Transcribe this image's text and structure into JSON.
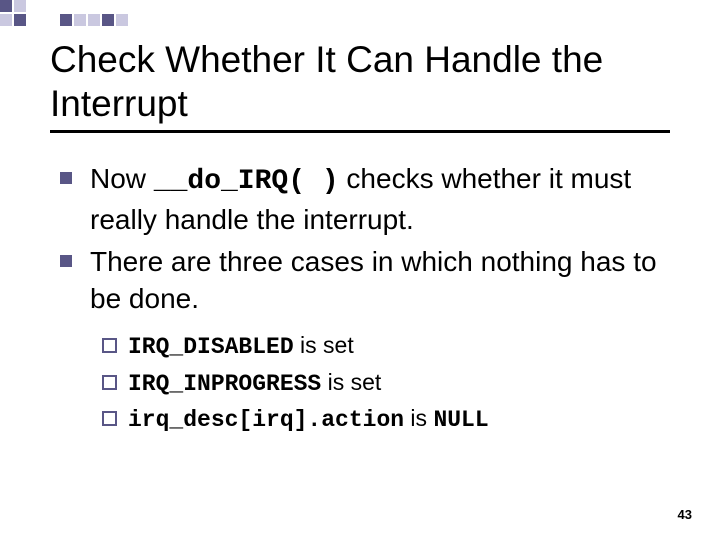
{
  "title": "Check Whether It Can Handle the Interrupt",
  "bullets": [
    {
      "pre": "Now ",
      "code": "__do_IRQ( )",
      "post": " checks whether it must really handle the interrupt."
    },
    {
      "pre": "There are three cases in which nothing has to be done.",
      "code": "",
      "post": ""
    }
  ],
  "subs": [
    {
      "code": "IRQ_DISABLED",
      "post": " is set"
    },
    {
      "code": "IRQ_INPROGRESS",
      "post": " is set"
    },
    {
      "code": "irq_desc[irq].action",
      "post": " is ",
      "post2code": "NULL"
    }
  ],
  "page": "43"
}
